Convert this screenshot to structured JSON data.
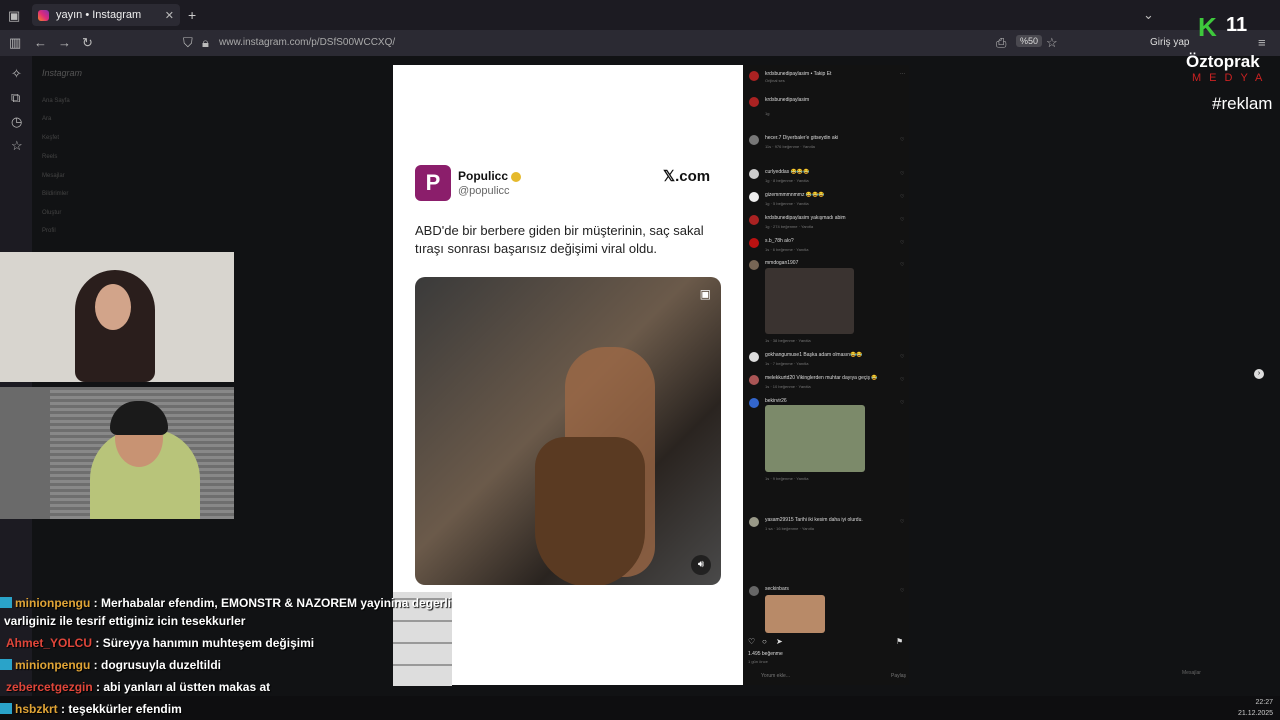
{
  "browser": {
    "tab_title": "yayın • Instagram",
    "tab_close": "✕",
    "new_tab": "+",
    "url": "www.instagram.com/p/DSfS00WCCXQ/",
    "zoom": "%50",
    "login": "Giriş yap"
  },
  "instagram_nav": {
    "logo": "Instagram",
    "items": [
      "Ana Sayfa",
      "Ara",
      "Keşfet",
      "Reels",
      "Mesajlar",
      "Bildirimler",
      "Oluştur",
      "Profil"
    ]
  },
  "tweet": {
    "avatar_letter": "P",
    "name": "Populicc",
    "handle": "@populicc",
    "source": "𝕏.com",
    "text": "ABD'de bir berbere giden bir müşterinin, saç sakal tıraşı sonrası başarısız değişimi viral oldu."
  },
  "comments_panel": {
    "header_user": "krdsbunedipaylasim • Takip Et",
    "header_sub": "Orijinal ses",
    "likes": "1.495 beğenme",
    "date": "1 gün önce",
    "comment_placeholder": "Yorum ekle...",
    "post_button": "Paylaş",
    "comments": [
      {
        "user": "krdsbunedipaylasim",
        "meta": "1g"
      },
      {
        "user": "hecer.7 Diyerbaler'e gitseydin aki",
        "meta": "11s · 976 beğenme · Yanıtla"
      },
      {
        "user": "curlyeddas 😂😂😂",
        "meta": "1g · 8 beğenme · Yanıtla"
      },
      {
        "user": "gizemmmmnmmz 😂😂😂",
        "meta": "1g · 5 beğenme · Yanıtla"
      },
      {
        "user": "krdsbunedipaylasim yakışmadı abim",
        "meta": "1g · 274 beğenme · Yanıtla"
      },
      {
        "user": "s.b_78h alo?",
        "meta": "1s · 6 beğenme · Yanıtla"
      },
      {
        "user": "mmdogan1907",
        "meta": "1s · 38 beğenme · Yanıtla"
      },
      {
        "user": "gokhangumuse1 Başka adam olmasın😂😂",
        "meta": "1s · 7 beğenme · Yanıtla"
      },
      {
        "user": "melekkurtd20 Vikinglerden muhtar dayıya geçiş 😂",
        "meta": "1s · 10 beğenme · Yanıtla"
      },
      {
        "user": "bekirvir26",
        "meta": "1s · 9 beğenme · Yanıtla"
      },
      {
        "user": "yasam29915 Tarihi iki kesim daha iyi olurdu.",
        "meta": "1 sa · 16 beğenme · Yanıtla"
      },
      {
        "user": "seckinbars",
        "meta": ""
      }
    ]
  },
  "chat": [
    {
      "user": "minionpengu",
      "message": ": Merhabalar efendim, EMONSTR & NAZOREM yayinina degerli",
      "red": false
    },
    {
      "user": "",
      "message": "varliginiz ile tesrif ettiginiz icin tesekkurler",
      "red": false
    },
    {
      "user": "Ahmet_YOLCU",
      "message": ": Süreyya hanımın muhteşem değişimi",
      "red": true
    },
    {
      "user": "minionpengu",
      "message": ": dogrusuyla duzeltildi",
      "red": false
    },
    {
      "user": "zebercetgezgin",
      "message": ": abi yanları al üstten makas at",
      "red": true
    },
    {
      "user": "hsbzkrt",
      "message": ": teşekkürler efendim",
      "red": false
    }
  ],
  "brand": {
    "k": "K",
    "number": "11",
    "name": "Öztoprak",
    "medya": "MEDYA",
    "reklam": "#reklam"
  },
  "taskbar": {
    "time": "22:27",
    "date": "21.12.2025"
  },
  "misc": {
    "messages": "Mesajlar"
  }
}
